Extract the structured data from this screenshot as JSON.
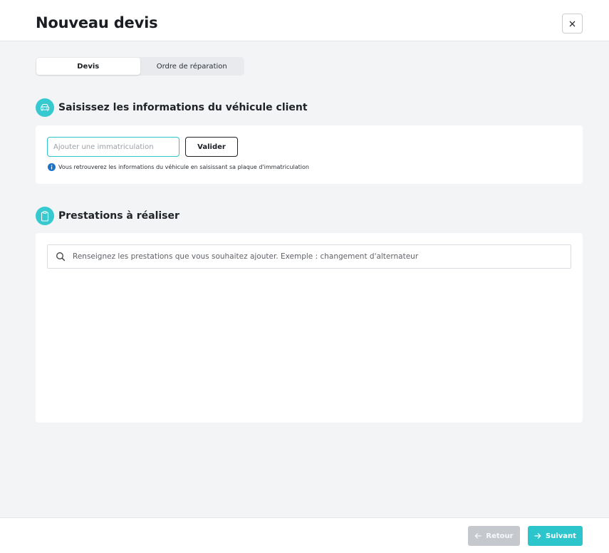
{
  "header": {
    "title": "Nouveau devis",
    "close_icon": "close-icon"
  },
  "tabs": [
    {
      "label": "Devis",
      "active": true
    },
    {
      "label": "Ordre de réparation",
      "active": false
    }
  ],
  "vehicle_section": {
    "icon": "car-icon",
    "title": "Saisissez les informations du véhicule client",
    "plate_input": {
      "value": "",
      "placeholder": "Ajouter une immatriculation"
    },
    "validate_label": "Valider",
    "hint_icon": "info-icon",
    "hint": "Vous retrouverez les informations du véhicule en saisissant sa plaque d'immatriculation"
  },
  "services_section": {
    "icon": "clipboard-icon",
    "title": "Prestations à réaliser",
    "search": {
      "value": "",
      "placeholder": "Renseignez les prestations que vous souhaitez ajouter. Exemple : changement d'alternateur"
    }
  },
  "footer": {
    "back_label": "Retour",
    "back_enabled": false,
    "next_label": "Suivant"
  },
  "colors": {
    "accent": "#2cc5cc",
    "accent_light": "#36c9cf",
    "info_blue": "#1a73c9",
    "disabled": "#c5c9ce"
  }
}
